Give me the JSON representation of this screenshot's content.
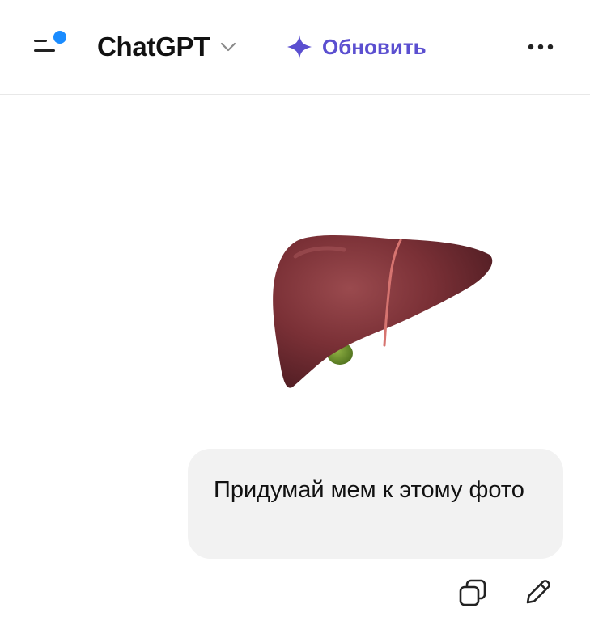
{
  "header": {
    "app_title": "ChatGPT",
    "upgrade_label": "Обновить",
    "icons": {
      "menu": "menu-icon",
      "notification_dot": "notification-dot",
      "chevron": "chevron-down-icon",
      "upgrade": "sparkle-icon",
      "more": "more-icon"
    }
  },
  "conversation": {
    "attachment": {
      "type": "image",
      "subject": "liver-image"
    },
    "user_message": {
      "text": "Придумай мем к этому фото"
    },
    "actions": {
      "copy": "copy-icon",
      "edit": "pencil-icon"
    }
  },
  "colors": {
    "accent_purple": "#5b4fd0",
    "notification_blue": "#1a8cff",
    "bubble_bg": "#f2f2f2",
    "text": "#111111"
  }
}
